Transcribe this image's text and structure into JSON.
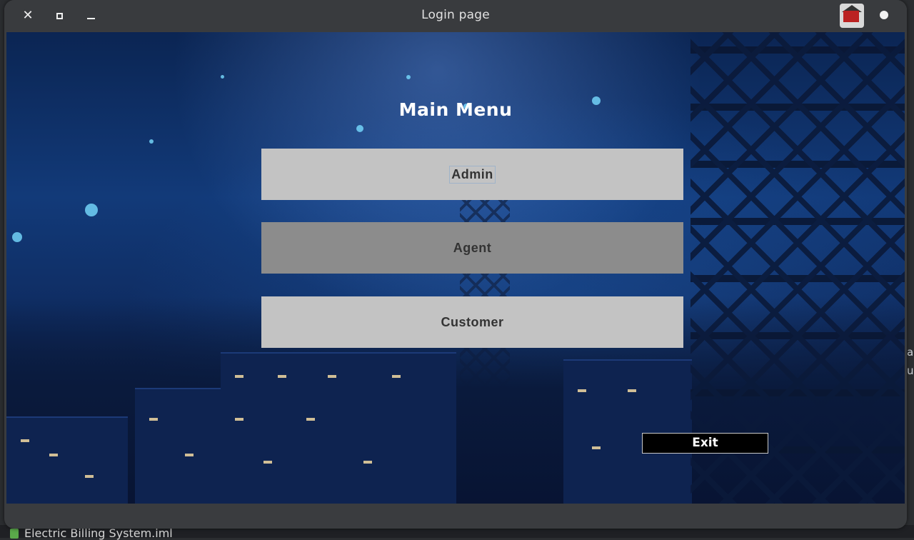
{
  "window": {
    "title": "Login page"
  },
  "main": {
    "heading": "Main Menu",
    "buttons": [
      {
        "label": "Admin"
      },
      {
        "label": "Agent"
      },
      {
        "label": "Customer"
      }
    ],
    "exit_label": "Exit"
  },
  "ide": {
    "file_label": "Electric Billing System.iml",
    "side_chars": [
      "a",
      "u"
    ]
  },
  "colors": {
    "button_bg": "#c3c3c3",
    "button_hover_bg": "#8c8c8c",
    "exit_bg": "#000000",
    "heading_text": "#ffffff"
  }
}
